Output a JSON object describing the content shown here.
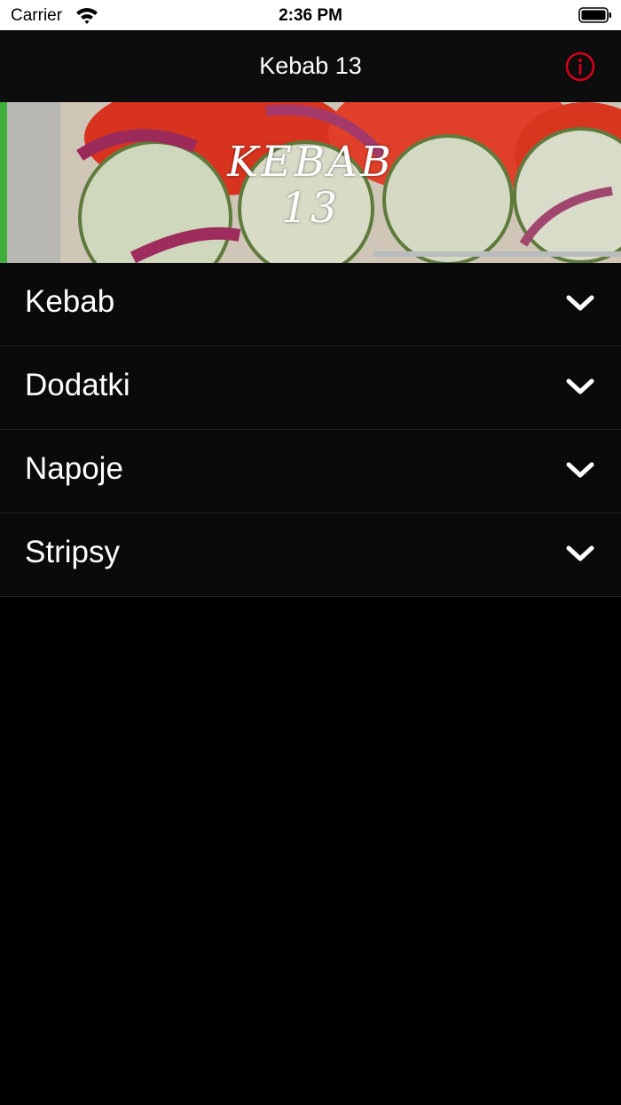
{
  "status_bar": {
    "carrier": "Carrier",
    "time": "2:36 PM"
  },
  "nav": {
    "title": "Kebab 13",
    "info_icon": "info-circle-icon",
    "info_color": "#d0021b"
  },
  "banner": {
    "line1": "KEBAB",
    "line2": "13"
  },
  "menu": {
    "items": [
      {
        "label": "Kebab"
      },
      {
        "label": "Dodatki"
      },
      {
        "label": "Napoje"
      },
      {
        "label": "Stripsy"
      }
    ],
    "chevron_icon": "chevron-down-icon"
  }
}
